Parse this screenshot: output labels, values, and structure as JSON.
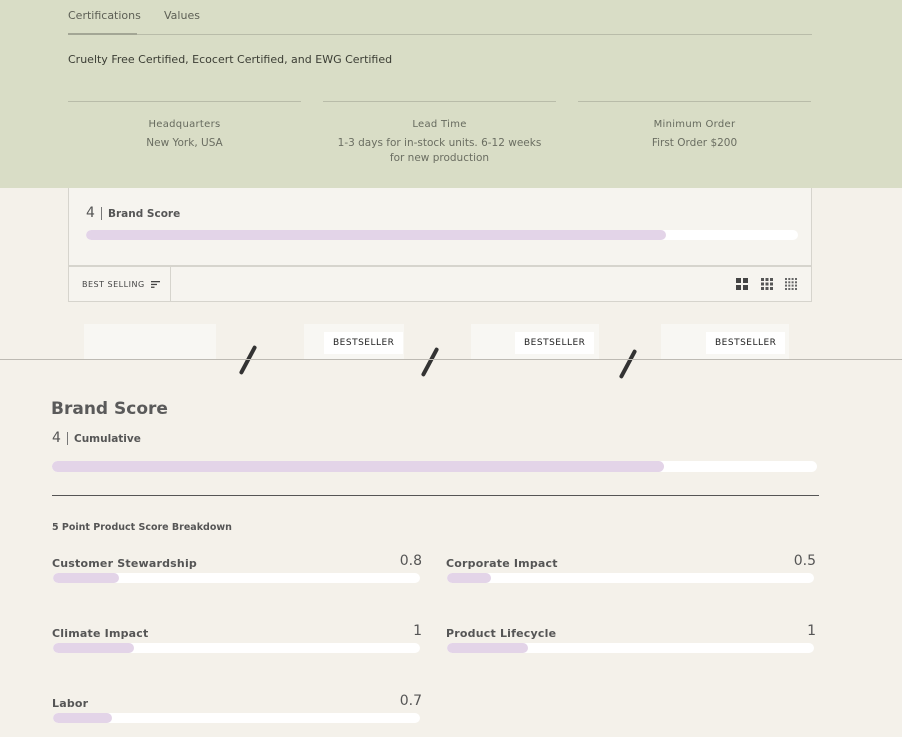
{
  "tabs": [
    {
      "label": "Certifications",
      "active": true
    },
    {
      "label": "Values",
      "active": false
    }
  ],
  "certifications_text": "Cruelty Free Certified, Ecocert Certified, and EWG Certified",
  "info": [
    {
      "label": "Headquarters",
      "value": "New York, USA"
    },
    {
      "label": "Lead Time",
      "value": "1-3 days for in-stock units. 6-12 weeks for new production"
    },
    {
      "label": "Minimum Order",
      "value": "First Order $200"
    }
  ],
  "brand_card": {
    "score": "4",
    "label": "Brand Score",
    "fill_fraction": 0.815
  },
  "toolbar": {
    "sort_label": "BEST SELLING",
    "sort_icon": "sort-lines-icon",
    "grid_icons": [
      "grid-large-icon",
      "grid-medium-icon",
      "grid-small-icon"
    ]
  },
  "products": [
    {
      "badge": ""
    },
    {
      "badge": "BESTSELLER"
    },
    {
      "badge": "BESTSELLER"
    },
    {
      "badge": "BESTSELLER"
    }
  ],
  "brand_score_section": {
    "title": "Brand Score",
    "score": "4",
    "label": "Cumulative",
    "fill_fraction": 0.8,
    "breakdown_title": "5 Point Product Score Breakdown"
  },
  "metrics": [
    {
      "label": "Customer Stewardship",
      "value": "0.8",
      "fill_fraction": 0.18
    },
    {
      "label": "Corporate Impact",
      "value": "0.5",
      "fill_fraction": 0.12
    },
    {
      "label": "Climate Impact",
      "value": "1",
      "fill_fraction": 0.22
    },
    {
      "label": "Product Lifecycle",
      "value": "1",
      "fill_fraction": 0.22
    },
    {
      "label": "Labor",
      "value": "0.7",
      "fill_fraction": 0.16
    }
  ],
  "colors": {
    "top_panel": "#d9ddc6",
    "page_background": "#f4f1ea",
    "bar_fill": "#e3d4e8",
    "bar_track": "#ffffff"
  }
}
